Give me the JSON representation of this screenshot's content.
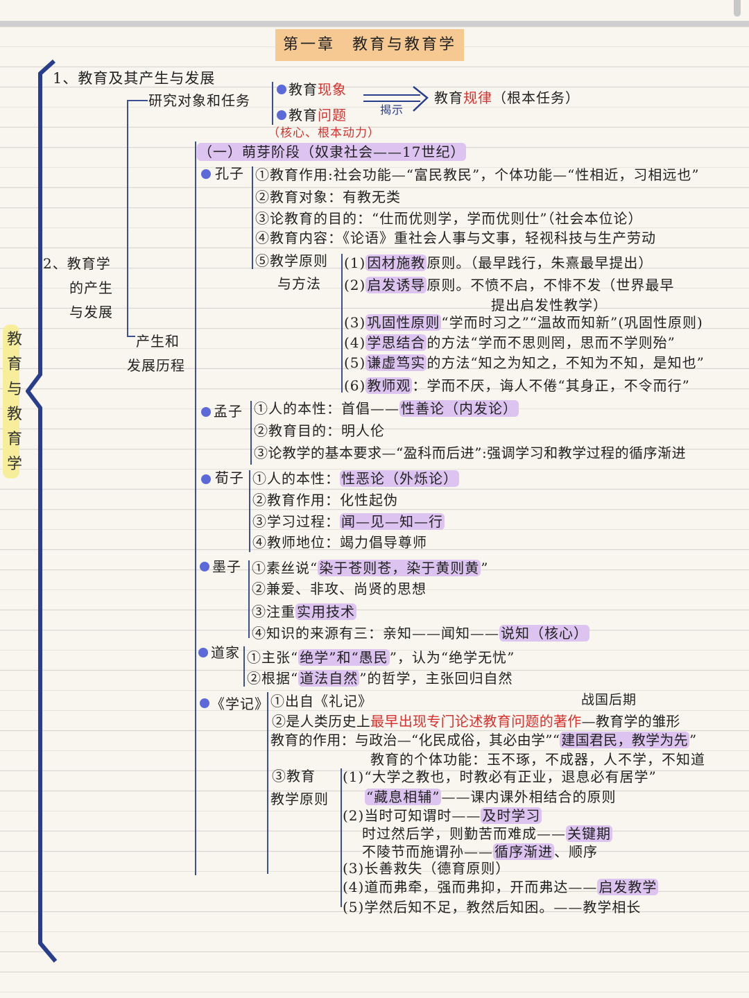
{
  "title": "第一章　教育与教育学",
  "side_label": [
    "教",
    "育",
    "与",
    "教",
    "育",
    "学"
  ],
  "section1": {
    "heading": "1、教育及其产生与发展",
    "research": "研究对象和任务",
    "item1_prefix": "教育",
    "item1_red": "现象",
    "item2_prefix": "教育",
    "item2_red": "问题",
    "core_note": "（核心、根本动力）",
    "arrow_label": "揭示",
    "result_prefix": "教育",
    "result_red": "规律",
    "result_suffix": "（根本任务）"
  },
  "section2": {
    "heading_lines": [
      "2、教育学",
      "的产生",
      "与发展"
    ],
    "sub_lines": [
      "产生和",
      "发展历程"
    ],
    "stage": "（一）萌芽阶段（奴隶社会——17世纪）"
  },
  "kongzi": {
    "name": "孔子",
    "l1": "①教育作用:社会功能—“富民教民”，个体功能—“性相近，习相远也”",
    "l2": "②教育对象：有教无类",
    "l3": "③论教育的目的：“仕而优则学，学而优则仕”（社会本位论）",
    "l4": "④教育内容：《论语》重社会人事与文事，轻视科技与生产劳动",
    "l5a": "⑤教学原则",
    "l5b": "与方法",
    "p1_pre": "(1)",
    "p1_hl": "因材施教",
    "p1_post": "原则。（最早践行，朱熹最早提出）",
    "p2_pre": "(2)",
    "p2_hl": "启发诱导",
    "p2_post": "原则。不愤不启，不悱不发（世界最早",
    "p2_cont": "提出启发性教学）",
    "p3_pre": "(3)",
    "p3_hl": "巩固性原则",
    "p3_post": "“学而时习之”“温故而知新”(巩固性原则)",
    "p4_pre": "(4)",
    "p4_hl": "学思结合",
    "p4_post": "的方法“学而不思则罔，思而不学则殆”",
    "p5_pre": "(5)",
    "p5_hl": "谦虚笃实",
    "p5_post": "的方法“知之为知之，不知为不知，是知也”",
    "p6_pre": "(6)",
    "p6_hl": "教师观",
    "p6_post": "：学而不厌，诲人不倦“其身正，不令而行”"
  },
  "mengzi": {
    "name": "孟子",
    "l1_pre": "①人的本性：首倡——",
    "l1_hl": "性善论（内发论）",
    "l2": "②教育目的：明人伦",
    "l3": "③论教学的基本要求—“盈科而后进”:强调学习和教学过程的循序渐进"
  },
  "xunzi": {
    "name": "荀子",
    "l1_pre": "①人的本性：",
    "l1_hl": "性恶论（外烁论）",
    "l2": "②教育作用：化性起伪",
    "l3_pre": "③学习过程：",
    "l3_hl": "闻—见—知—行",
    "l4": "④教师地位：竭力倡导尊师"
  },
  "mozi": {
    "name": "墨子",
    "l1_pre": "①素丝说“",
    "l1_hl": "染于苍则苍，染于黄则黄",
    "l1_post": "”",
    "l2": "②兼爱、非攻、尚贤的思想",
    "l3_pre": "③注重",
    "l3_hl": "实用技术",
    "l4_pre": "④知识的来源有三：亲知——闻知——",
    "l4_hl": "说知（核心）"
  },
  "daojia": {
    "name": "道家",
    "l1_pre": "①主张“",
    "l1_hl": "绝学”和“愚民",
    "l1_post": "”，认为“绝学无忧”",
    "l2_pre": "②根据“",
    "l2_hl": "道法自然",
    "l2_post": "”的哲学，主张回归自然"
  },
  "xueji": {
    "name": "《学记》",
    "l1": "①出自《礼记》",
    "period": "战国后期",
    "l2_pre": "②是人类历史上",
    "l2_red": "最早出现专门论述教育问题的著作",
    "l2_post": "—教育学的雏形",
    "l3_pre": "教育的作用：与政治—“化民成俗，其必由学”“",
    "l3_hl": "建国君民，教学为先",
    "l3_post": "”",
    "l4": "教育的个体功能：玉不琢，不成器，人不学，不知道",
    "l5a": "③教育",
    "l5b": "教学原则",
    "r1": "(1)“大学之教也，时教必有正业，退息必有居学”",
    "r1b_hl": "“藏息相辅”",
    "r1b_post": "——课内课外相结合的原则",
    "r2_pre": "(2)当时可知谓时——",
    "r2_hl": "及时学习",
    "r2b_pre": "时过然后学，则勤苦而难成——",
    "r2b_hl": "关键期",
    "r2c_pre": "不陵节而施谓孙——",
    "r2c_hl": "循序渐进",
    "r2c_post": "、顺序",
    "r3": "(3)长善救失（德育原则）",
    "r4_pre": "(4)道而弗牵，强而弗抑，开而弗达——",
    "r4_hl": "启发教学",
    "r5": "(5)学然后知不足，教然后知困。——教学相长"
  }
}
